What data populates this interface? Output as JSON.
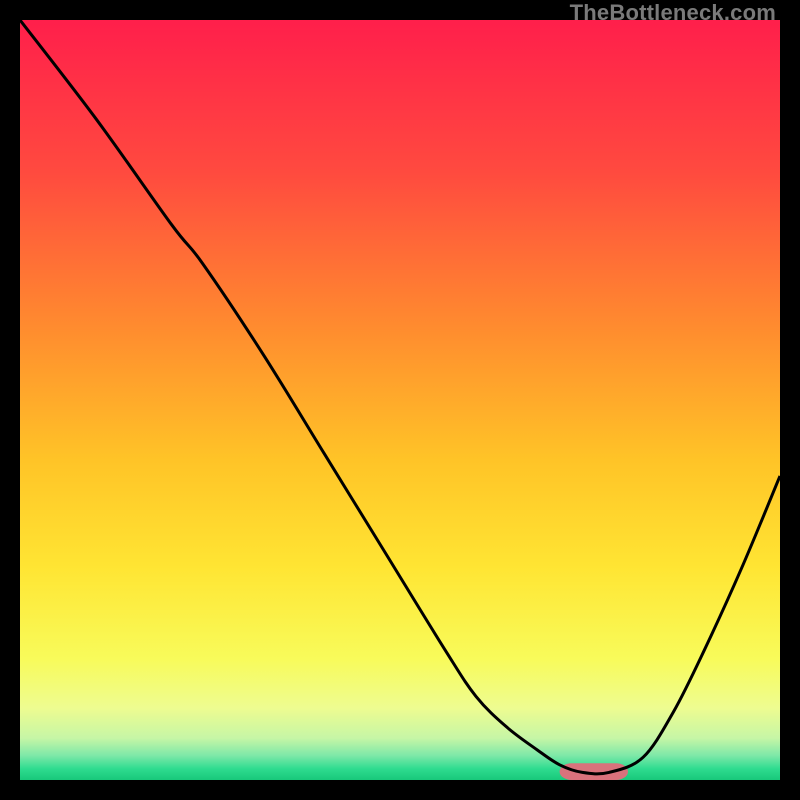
{
  "watermark": "TheBottleneck.com",
  "chart_data": {
    "type": "line",
    "title": "",
    "xlabel": "",
    "ylabel": "",
    "xlim": [
      0,
      100
    ],
    "ylim": [
      0,
      100
    ],
    "grid": false,
    "legend": false,
    "series": [
      {
        "name": "curve",
        "x": [
          0,
          10,
          20,
          24,
          32,
          40,
          48,
          56,
          60,
          64,
          68,
          71,
          74,
          77.5,
          82,
          86,
          90,
          95,
          100
        ],
        "y": [
          100,
          87,
          73,
          68,
          56,
          43,
          30,
          17,
          11,
          7,
          4,
          2,
          1,
          1,
          3,
          9,
          17,
          28,
          40
        ]
      }
    ],
    "gradient_stops": [
      {
        "offset": 0.0,
        "color": "#ff1f4b"
      },
      {
        "offset": 0.2,
        "color": "#ff4a3f"
      },
      {
        "offset": 0.4,
        "color": "#ff8a2f"
      },
      {
        "offset": 0.58,
        "color": "#ffc427"
      },
      {
        "offset": 0.72,
        "color": "#ffe533"
      },
      {
        "offset": 0.84,
        "color": "#f8fb5a"
      },
      {
        "offset": 0.905,
        "color": "#eefc90"
      },
      {
        "offset": 0.945,
        "color": "#c6f6a6"
      },
      {
        "offset": 0.968,
        "color": "#7de8a8"
      },
      {
        "offset": 0.985,
        "color": "#2fdc90"
      },
      {
        "offset": 1.0,
        "color": "#18c87a"
      }
    ],
    "marker": {
      "x_center": 75.5,
      "width": 9,
      "color": "#d9727c",
      "radius": 1.6
    }
  }
}
